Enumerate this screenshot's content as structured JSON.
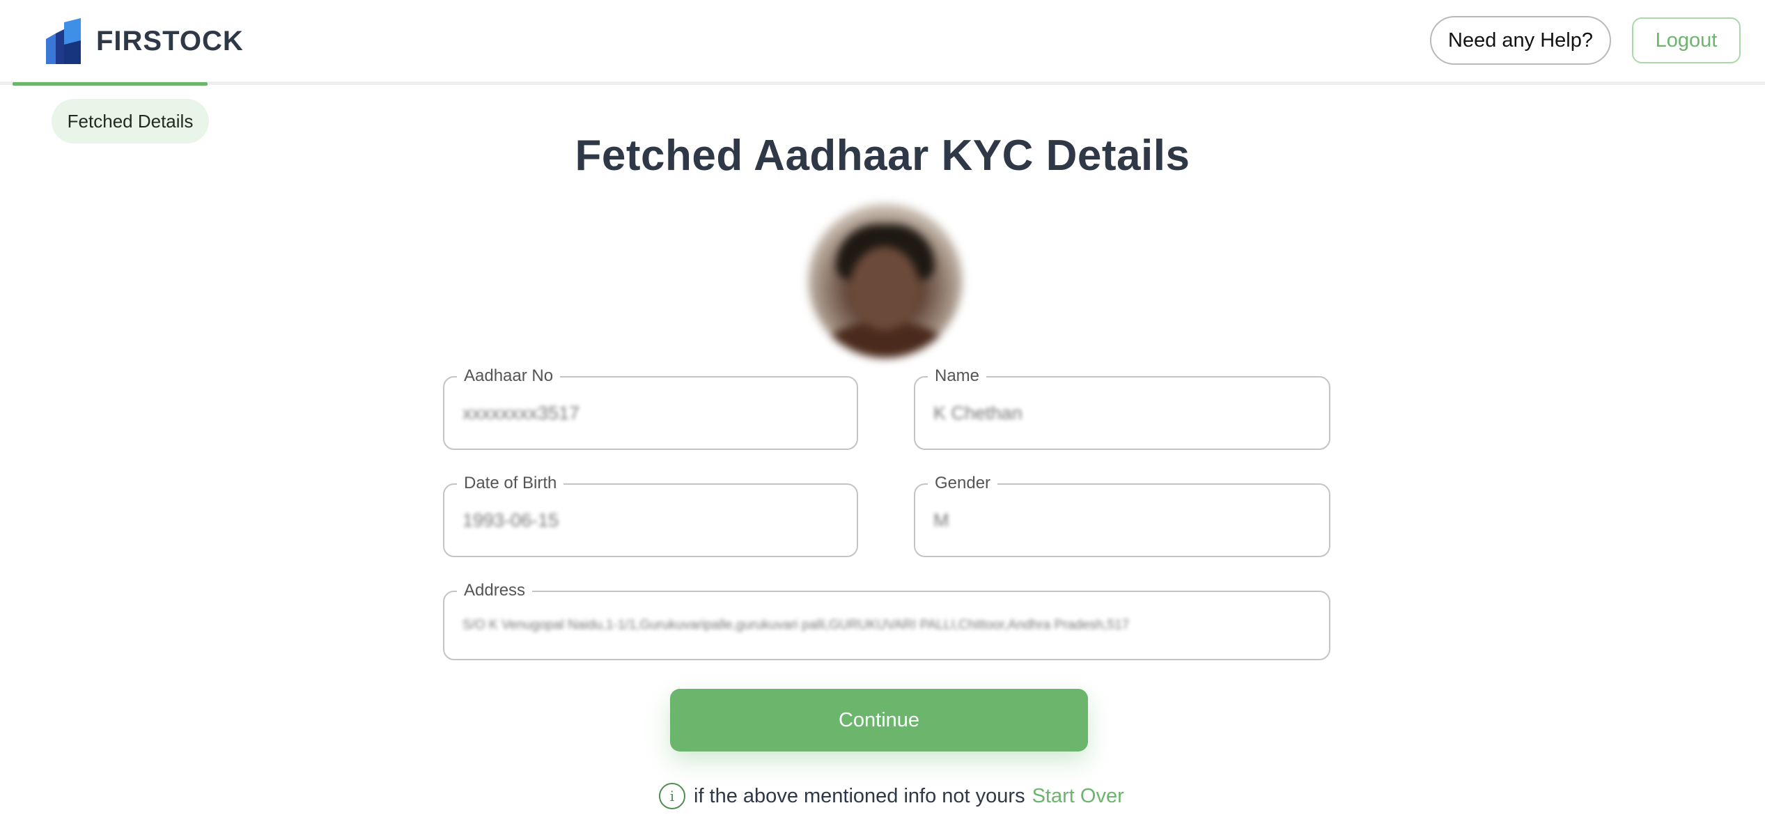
{
  "header": {
    "brand_name": "FIRSTOCK",
    "help_label": "Need any Help?",
    "logout_label": "Logout"
  },
  "step": {
    "label": "Fetched Details"
  },
  "main": {
    "title": "Fetched Aadhaar KYC Details",
    "fields": {
      "aadhaar_no": {
        "label": "Aadhaar No",
        "value": "xxxxxxxx3517"
      },
      "name": {
        "label": "Name",
        "value": "K Chethan"
      },
      "dob": {
        "label": "Date of Birth",
        "value": "1993-06-15"
      },
      "gender": {
        "label": "Gender",
        "value": "M"
      },
      "address": {
        "label": "Address",
        "value": "S/O K Venugopal Naidu,1-1/1,Gurukuvaripalle,gurukuvari palli,GURUKUVARI PALLI,Chittoor,Andhra Pradesh,517"
      }
    },
    "continue_label": "Continue",
    "note_text": "if the above mentioned info not yours",
    "start_over_label": "Start Over"
  },
  "colors": {
    "accent": "#6cb56c",
    "text_dark": "#2f3847",
    "pill_bg": "#eaf5ea"
  },
  "icons": {
    "logo": "firstock-logo-icon",
    "info": "info-icon"
  }
}
